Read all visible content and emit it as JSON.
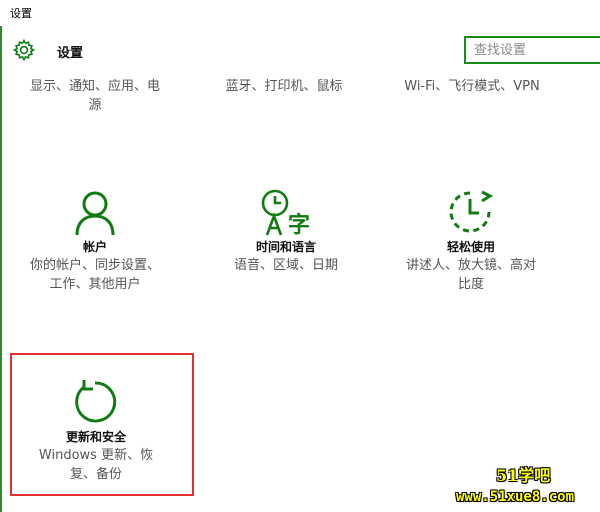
{
  "window": {
    "title": "设置"
  },
  "header": {
    "title": "设置",
    "icon": "gear-icon"
  },
  "search": {
    "placeholder": "查找设置"
  },
  "top_row": [
    {
      "desc_line1": "显示、通知、应用、电",
      "desc_line2": "源"
    },
    {
      "desc_line1": "蓝牙、打印机、鼠标"
    },
    {
      "desc_line1": "Wi-Fi、飞行模式、VPN"
    }
  ],
  "tiles": [
    {
      "icon": "person-icon",
      "title": "帐户",
      "desc_line1": "你的帐户、同步设置、",
      "desc_line2": "工作、其他用户"
    },
    {
      "icon": "time-language-icon",
      "title": "时间和语言",
      "desc_line1": "语音、区域、日期"
    },
    {
      "icon": "ease-of-access-icon",
      "title": "轻松使用",
      "desc_line1": "讲述人、放大镜、高对",
      "desc_line2": "比度"
    },
    {
      "icon": "update-refresh-icon",
      "title": "更新和安全",
      "desc_line1": "Windows 更新、恢",
      "desc_line2": "复、备份"
    }
  ],
  "colors": {
    "accent": "#107c10",
    "highlight": "#e0302f",
    "watermark": "#ffff00"
  },
  "watermark": {
    "line1": "51学吧",
    "line2": "www.51xue8.com"
  }
}
